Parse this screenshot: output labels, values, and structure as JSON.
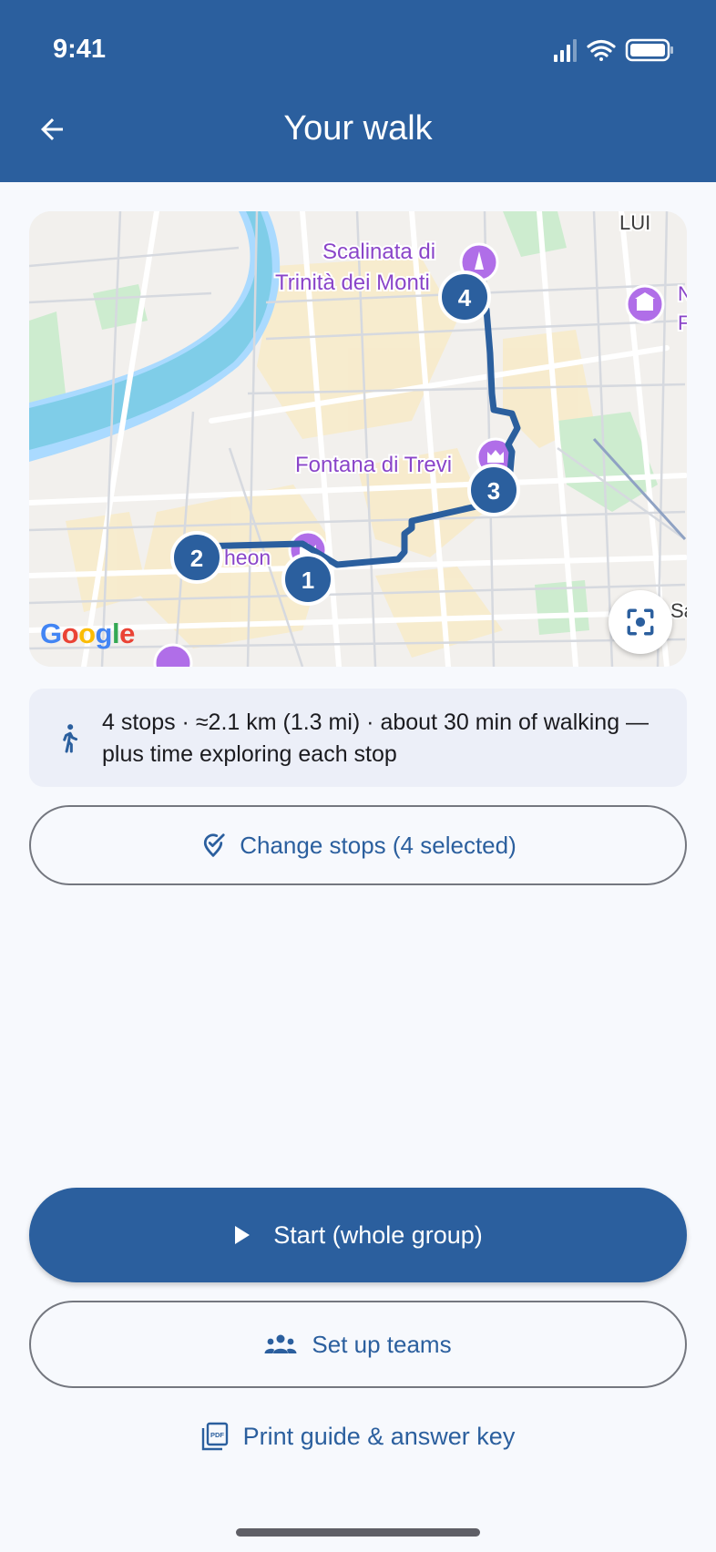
{
  "status_bar": {
    "time": "9:41"
  },
  "header": {
    "title": "Your walk",
    "back_icon": "arrow-left-icon"
  },
  "map": {
    "places": [
      "Scalinata di",
      "Trinità dei Monti",
      "Fontana di Trevi",
      "heon",
      "LUI"
    ],
    "partial_labels": [
      "N",
      "F",
      "Sa"
    ],
    "stops": [
      "1",
      "2",
      "3",
      "4"
    ],
    "attribution": [
      "G",
      "o",
      "o",
      "g",
      "l",
      "e"
    ],
    "route_color": "#2b5f9e",
    "poi_color": "#b06ee8"
  },
  "summary": {
    "icon": "walking-person-icon",
    "text": "4 stops · ≈2.1 km (1.3 mi) · about 30 min of walking — plus time exploring each stop"
  },
  "actions": {
    "change_stops": "Change stops (4 selected)",
    "start": "Start (whole group)",
    "teams": "Set up teams",
    "print": "Print guide & answer key"
  },
  "colors": {
    "primary": "#2b5f9e",
    "background": "#f7f9fd",
    "summary_bg": "#eceff8"
  }
}
